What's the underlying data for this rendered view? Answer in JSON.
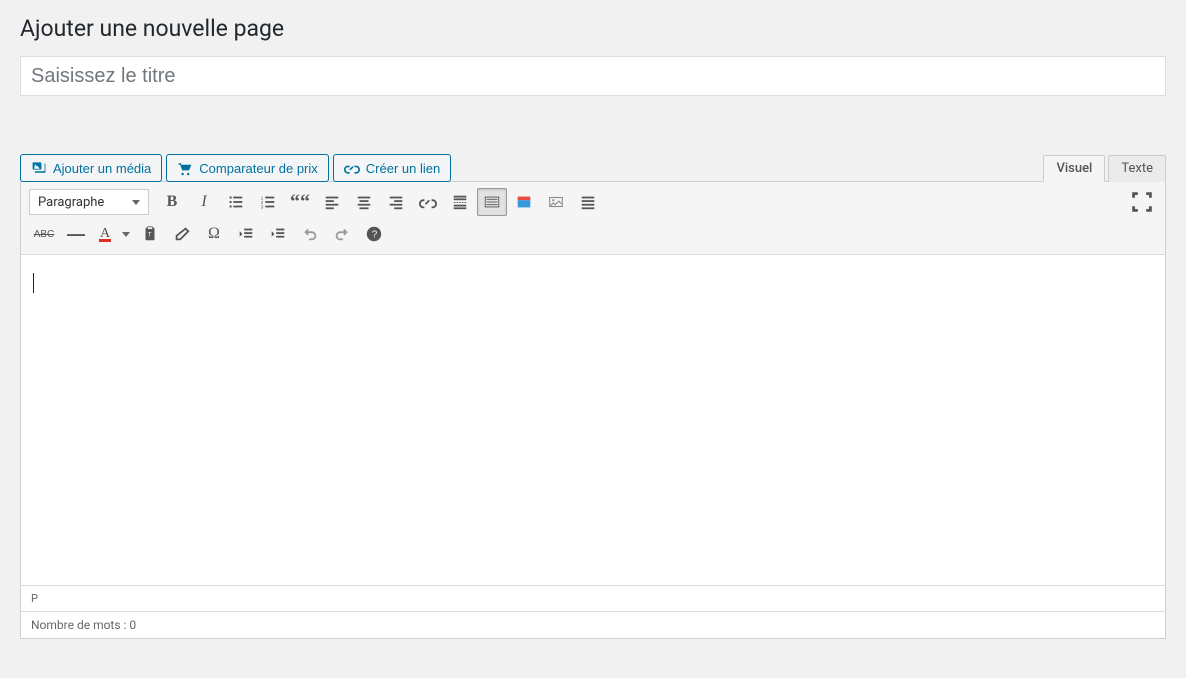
{
  "heading": "Ajouter une nouvelle page",
  "title_placeholder": "Saisissez le titre",
  "buttons": {
    "add_media": "Ajouter un média",
    "price_compare": "Comparateur de prix",
    "create_link": "Créer un lien"
  },
  "tabs": {
    "visual": "Visuel",
    "text": "Texte"
  },
  "format_select": "Paragraphe",
  "status": {
    "path": "p",
    "word_count": "Nombre de mots : 0"
  }
}
